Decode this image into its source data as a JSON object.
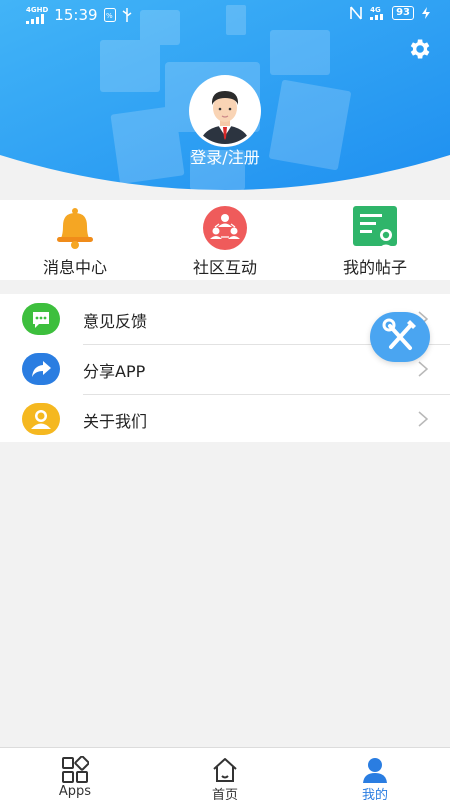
{
  "status_bar": {
    "network_left": "4GHD",
    "time": "15:39",
    "network_right": "4G",
    "battery": "93"
  },
  "header": {
    "login_label": "登录/注册",
    "settings_icon": "gear-icon",
    "avatar_icon": "user-avatar-icon"
  },
  "quick_menu": [
    {
      "label": "消息中心",
      "icon": "bell-icon"
    },
    {
      "label": "社区互动",
      "icon": "community-icon"
    },
    {
      "label": "我的帖子",
      "icon": "posts-icon"
    }
  ],
  "menu_list": [
    {
      "label": "意见反馈",
      "icon": "feedback-icon",
      "color": "#3dbf3d"
    },
    {
      "label": "分享APP",
      "icon": "share-icon",
      "color": "#2a7de1"
    },
    {
      "label": "关于我们",
      "icon": "about-icon",
      "color": "#f5b820"
    }
  ],
  "fab": {
    "icon": "tools-icon"
  },
  "bottom_nav": [
    {
      "label": "Apps",
      "icon": "apps-grid-icon"
    },
    {
      "label": "首页",
      "icon": "home-icon"
    },
    {
      "label": "我的",
      "icon": "profile-icon",
      "active": true
    }
  ],
  "colors": {
    "header_blue": "#2196f3",
    "active_tab": "#2a7de1"
  }
}
